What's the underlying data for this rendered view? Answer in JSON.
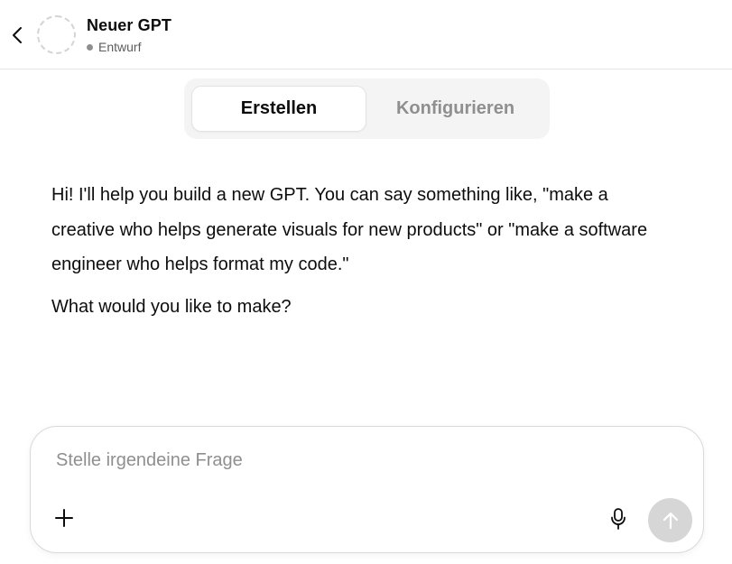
{
  "header": {
    "gpt_name": "Neuer GPT",
    "status": "Entwurf",
    "back_icon": "chevron-left-icon"
  },
  "tabs": [
    {
      "label": "Erstellen",
      "active": true
    },
    {
      "label": "Konfigurieren",
      "active": false
    }
  ],
  "message": {
    "paragraphs": [
      "Hi! I'll help you build a new GPT. You can say something like, \"make a creative who helps generate visuals for new products\" or \"make a software engineer who helps format my code.\"",
      "What would you like to make?"
    ]
  },
  "composer": {
    "placeholder": "Stelle irgendeine Frage",
    "value": "",
    "icons": {
      "add": "plus-icon",
      "voice": "microphone-icon",
      "send": "arrow-up-icon"
    }
  },
  "colors": {
    "send_button_disabled": "#d6d6d6",
    "status_dot": "#8f8f8f",
    "inactive_tab_text": "#8f8f8f"
  }
}
